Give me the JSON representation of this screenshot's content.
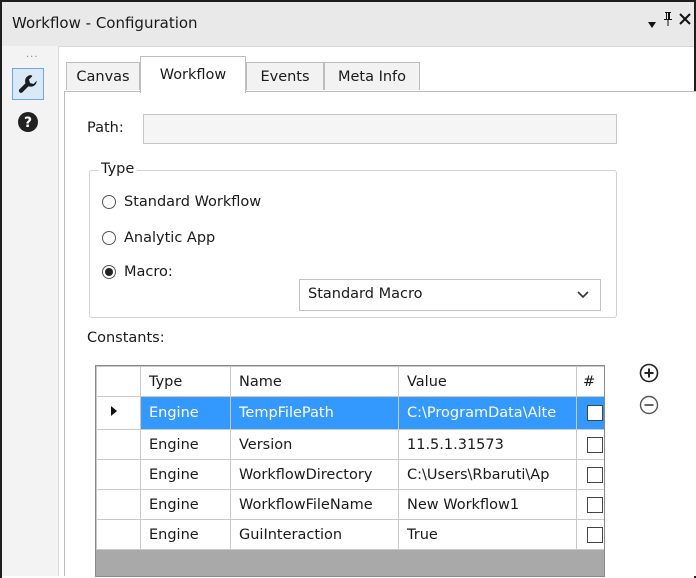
{
  "window": {
    "title": "Workflow - Configuration"
  },
  "leftbar": {
    "icons": [
      "wrench-icon",
      "help-icon"
    ]
  },
  "tabs": [
    {
      "label": "Canvas",
      "selected": false
    },
    {
      "label": "Workflow",
      "selected": true
    },
    {
      "label": "Events",
      "selected": false
    },
    {
      "label": "Meta Info",
      "selected": false
    }
  ],
  "path": {
    "label": "Path:",
    "value": ""
  },
  "type": {
    "title": "Type",
    "options": [
      "Standard Workflow",
      "Analytic App",
      "Macro:"
    ],
    "selected": "Macro:",
    "macro_select": "Standard Macro"
  },
  "constants": {
    "label": "Constants:",
    "columns": [
      "Type",
      "Name",
      "Value",
      "#"
    ],
    "rows": [
      {
        "type": "Engine",
        "name": "TempFilePath",
        "value": "C:\\ProgramData\\Alte",
        "checked": false,
        "selected": true
      },
      {
        "type": "Engine",
        "name": "Version",
        "value": "11.5.1.31573",
        "checked": false,
        "selected": false
      },
      {
        "type": "Engine",
        "name": "WorkflowDirectory",
        "value": "C:\\Users\\Rbaruti\\Ap",
        "checked": false,
        "selected": false
      },
      {
        "type": "Engine",
        "name": "WorkflowFileName",
        "value": "New Workflow1",
        "checked": false,
        "selected": false
      },
      {
        "type": "Engine",
        "name": "GuiInteraction",
        "value": "True",
        "checked": false,
        "selected": false
      }
    ]
  },
  "colors": {
    "selection": "#3399ff",
    "titlebar": "#e9e9e9"
  }
}
